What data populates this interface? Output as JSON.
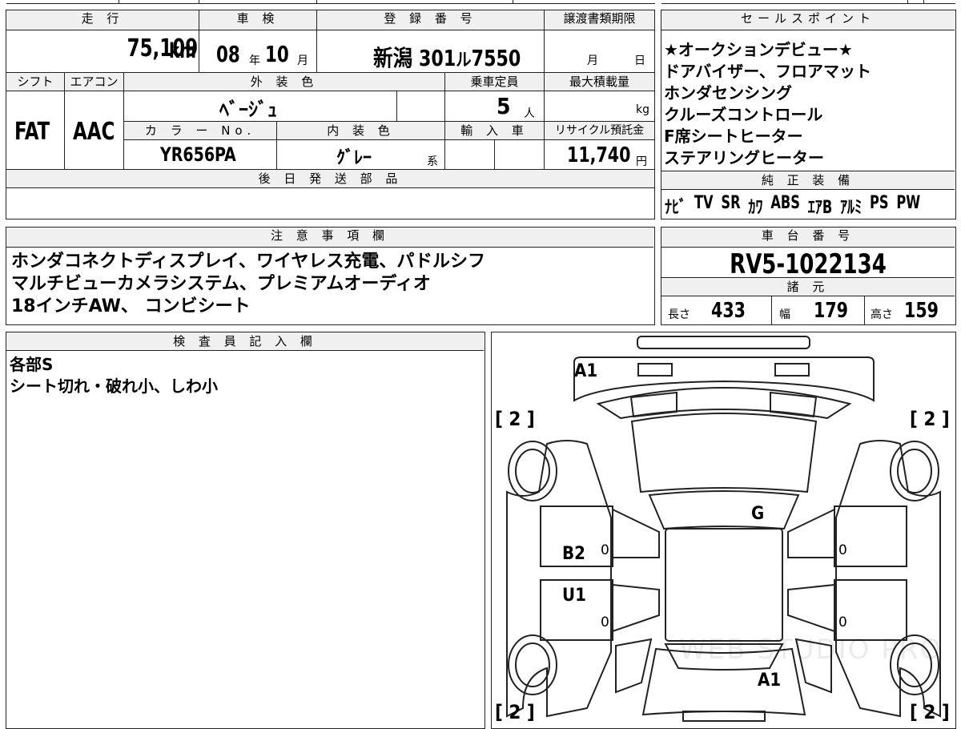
{
  "top_info": {
    "headers": {
      "mileage": "走 行",
      "inspection": "車 検",
      "registration": "登 録 番 号",
      "transfer_deadline": "譲渡書類期限"
    },
    "mileage_value": "75,109",
    "mileage_unit": "km",
    "inspection_year": "08",
    "inspection_year_unit": "年",
    "inspection_month": "10",
    "inspection_month_unit": "月",
    "registration_area": "新潟",
    "registration_class": "301",
    "registration_kana": "ル",
    "registration_number": "7550",
    "transfer_month_unit": "月",
    "transfer_day_unit": "日"
  },
  "spec": {
    "headers": {
      "shift": "シフト",
      "aircon": "エアコン",
      "exterior_color": "外 装 色",
      "capacity": "乗車定員",
      "max_load": "最大積載量",
      "color_no": "カ ラ ー No.",
      "interior_color": "内 装 色",
      "import": "輸 入 車",
      "recycle": "リサイクル預託金"
    },
    "shift": "FAT",
    "aircon": "AAC",
    "exterior_color": "ﾍﾞｰｼﾞｭ",
    "capacity": "5",
    "capacity_unit": "人",
    "max_load_unit": "kg",
    "color_no": "YR656PA",
    "interior_color": "ｸﾞﾚｰ",
    "interior_suffix": "系",
    "recycle_fee": "11,740",
    "recycle_unit": "円"
  },
  "later_parts": {
    "header": "後 日 発 送 部 品"
  },
  "sales_points": {
    "header": "セールスポイント",
    "lines": [
      "★オークションデビュー★",
      "ドアバイザー、フロアマット",
      "ホンダセンシング",
      "クルーズコントロール",
      "F席シートヒーター",
      "ステアリングヒーター"
    ]
  },
  "equipment": {
    "header": "純 正 装 備",
    "items": [
      "ﾅﾋﾞ",
      "TV",
      "SR",
      "ｶﾜ",
      "ABS",
      "ｴｱB",
      "ｱﾙﾐ",
      "PS",
      "PW"
    ]
  },
  "notes": {
    "header": "注 意 事 項 欄",
    "lines": [
      "ホンダコネクトディスプレイ、ワイヤレス充電、パドルシフ",
      "マルチビューカメラシステム、プレミアムオーディオ",
      "18インチAW、 コンビシート"
    ]
  },
  "chassis": {
    "header": "車 台 番 号",
    "number": "RV5-1022134"
  },
  "dimensions": {
    "header": "諸 元",
    "length_label": "長さ",
    "length": "433",
    "width_label": "幅",
    "width": "179",
    "height_label": "高さ",
    "height": "159"
  },
  "inspector": {
    "header": "検 査 員 記 入 欄",
    "lines": [
      "各部S",
      "シート切れ・破れ小、しわ小"
    ]
  },
  "diagram": {
    "marks": {
      "front_bumper": "A1",
      "windshield": "G",
      "left_door": "B2",
      "left_rear_door": "U1",
      "rear": "A1"
    },
    "tire_labels": [
      "[ 2 ]",
      "[ 2 ]",
      "[ 2 ]",
      "[ 2 ]"
    ],
    "zero_labels": [
      "0",
      "0",
      "0",
      "0"
    ],
    "watermark": "WEB STUDIO PRO"
  }
}
